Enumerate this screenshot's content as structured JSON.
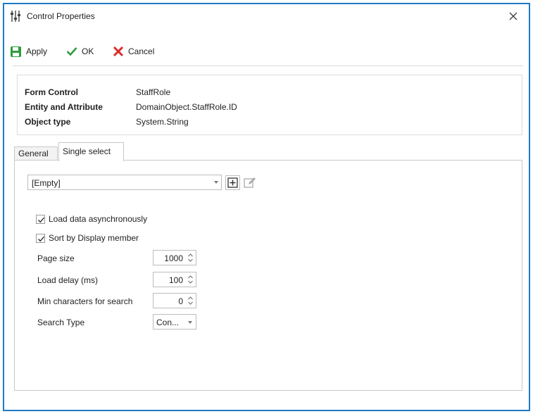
{
  "window": {
    "title": "Control Properties",
    "accent_color": "#1e7ac8",
    "close_icon": "close-icon"
  },
  "toolbar": {
    "apply_label": "Apply",
    "ok_label": "OK",
    "cancel_label": "Cancel",
    "apply_color": "#2e9b3e",
    "ok_color": "#2e9b3e",
    "cancel_color": "#d92b2b"
  },
  "info": {
    "rows": [
      {
        "label": "Form Control",
        "value": "StaffRole"
      },
      {
        "label": "Entity and Attribute",
        "value": "DomainObject.StaffRole.ID"
      },
      {
        "label": "Object type",
        "value": "System.String"
      }
    ]
  },
  "tabs": [
    {
      "label": "General",
      "active": false
    },
    {
      "label": "Single select",
      "active": true
    }
  ],
  "single_select": {
    "data_source": {
      "value": "[Empty]"
    },
    "load_async": {
      "label": "Load data asynchronously",
      "checked": true
    },
    "sort_display": {
      "label": "Sort by Display member",
      "checked": true
    },
    "page_size": {
      "label": "Page size",
      "value": "1000"
    },
    "load_delay": {
      "label": "Load delay (ms)",
      "value": "100"
    },
    "min_chars": {
      "label": "Min characters for search",
      "value": "0"
    },
    "search_type": {
      "label": "Search Type",
      "value": "Con..."
    }
  }
}
